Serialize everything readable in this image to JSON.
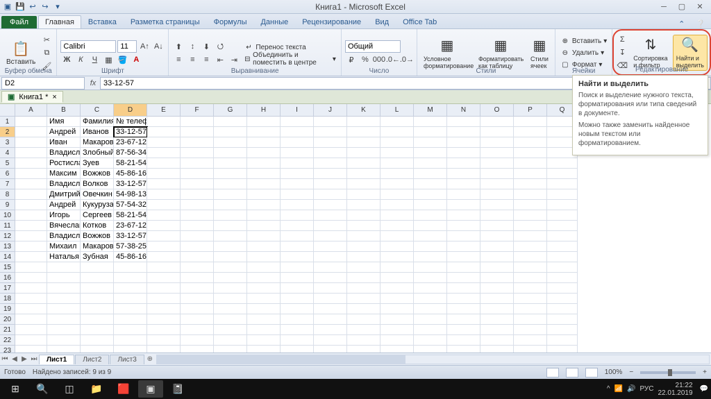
{
  "title": "Книга1 - Microsoft Excel",
  "qat": [
    "💾",
    "↩",
    "↪"
  ],
  "tabs": {
    "file": "Файл",
    "items": [
      "Главная",
      "Вставка",
      "Разметка страницы",
      "Формулы",
      "Данные",
      "Рецензирование",
      "Вид",
      "Office Tab"
    ],
    "active": 0
  },
  "ribbon": {
    "clipboard": {
      "label": "Буфер обмена",
      "paste": "Вставить"
    },
    "font": {
      "label": "Шрифт",
      "name": "Calibri",
      "size": "11"
    },
    "align": {
      "label": "Выравнивание",
      "wrap": "Перенос текста",
      "merge": "Объединить и поместить в центре"
    },
    "number": {
      "label": "Число",
      "format": "Общий"
    },
    "styles": {
      "label": "Стили",
      "cond": "Условное форматирование",
      "table": "Форматировать как таблицу",
      "cell": "Стили ячеек"
    },
    "cells": {
      "label": "Ячейки",
      "insert": "Вставить",
      "delete": "Удалить",
      "format": "Формат"
    },
    "edit": {
      "label": "Редактирование",
      "sort": "Сортировка и фильтр",
      "find": "Найти и выделить"
    }
  },
  "namebox": "D2",
  "formula": "33-12-57",
  "doctab": "Книга1 *",
  "columns": [
    "A",
    "B",
    "C",
    "D",
    "E",
    "F",
    "G",
    "H",
    "I",
    "J",
    "K",
    "L",
    "M",
    "N",
    "O",
    "P",
    "Q"
  ],
  "headers": {
    "B": "Имя",
    "C": "Фамилия",
    "D": "№ телефона"
  },
  "data": [
    {
      "b": "Андрей",
      "c": "Иванов",
      "d": "33-12-57"
    },
    {
      "b": "Иван",
      "c": "Макаров",
      "d": "23-67-12"
    },
    {
      "b": "Владислав",
      "c": "Злобный",
      "d": "87-56-34"
    },
    {
      "b": "Ростислав",
      "c": "Зуев",
      "d": "58-21-54"
    },
    {
      "b": "Максим",
      "c": "Вожжов",
      "d": "45-86-16"
    },
    {
      "b": "Владислав",
      "c": "Волков",
      "d": "33-12-57"
    },
    {
      "b": "Дмитрий",
      "c": "Овечкин",
      "d": "54-98-13"
    },
    {
      "b": "Андрей",
      "c": "Кукуруза",
      "d": "57-54-32"
    },
    {
      "b": "Игорь",
      "c": "Сергеев",
      "d": "58-21-54"
    },
    {
      "b": "Вячеслав",
      "c": "Котков",
      "d": "23-67-12"
    },
    {
      "b": "Владислав",
      "c": "Вожжов",
      "d": "33-12-57"
    },
    {
      "b": "Михаил",
      "c": "Макаров",
      "d": "57-38-25"
    },
    {
      "b": "Наталья",
      "c": "Зубная",
      "d": "45-86-16"
    }
  ],
  "totalRows": 25,
  "selected": {
    "row": 2,
    "col": "D"
  },
  "tooltip": {
    "title": "Найти и выделить",
    "p1": "Поиск и выделение нужного текста, форматирования или типа сведений в документе.",
    "p2": "Можно также заменить найденное новым текстом или форматированием."
  },
  "sheets": {
    "items": [
      "Лист1",
      "Лист2",
      "Лист3"
    ],
    "active": 0
  },
  "status": {
    "ready": "Готово",
    "found": "Найдено записей: 9 из 9",
    "zoom": "100%"
  },
  "tray": {
    "lang": "РУС",
    "time": "21:22",
    "date": "22.01.2019"
  }
}
